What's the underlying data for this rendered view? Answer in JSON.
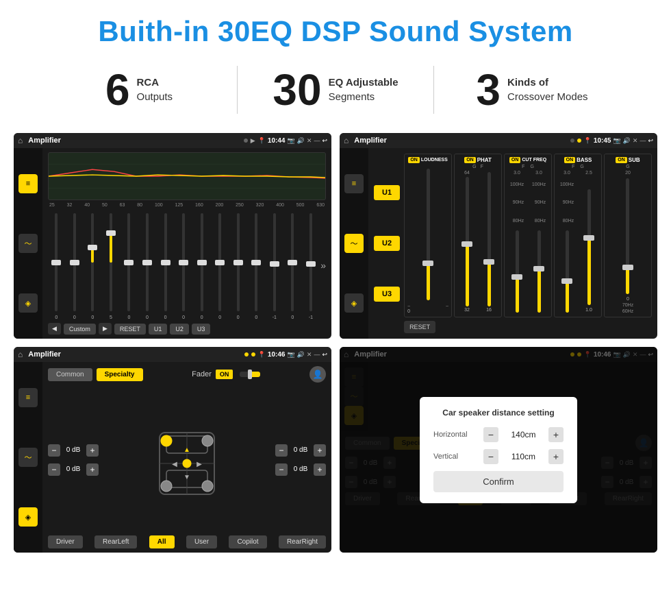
{
  "page": {
    "title": "Buith-in 30EQ DSP Sound System",
    "stats": [
      {
        "number": "6",
        "line1": "RCA",
        "line2": "Outputs"
      },
      {
        "number": "30",
        "line1": "EQ Adjustable",
        "line2": "Segments"
      },
      {
        "number": "3",
        "line1": "Kinds of",
        "line2": "Crossover Modes"
      }
    ]
  },
  "screens": {
    "eq": {
      "title": "Amplifier",
      "time": "10:44",
      "freqs": [
        "25",
        "32",
        "40",
        "50",
        "63",
        "80",
        "100",
        "125",
        "160",
        "200",
        "250",
        "320",
        "400",
        "500",
        "630"
      ],
      "vals": [
        "0",
        "0",
        "0",
        "5",
        "0",
        "0",
        "0",
        "0",
        "0",
        "0",
        "0",
        "0",
        "-1",
        "0",
        "-1"
      ],
      "buttons": [
        "Custom",
        "RESET",
        "U1",
        "U2",
        "U3"
      ]
    },
    "crossover": {
      "title": "Amplifier",
      "time": "10:45",
      "u_buttons": [
        "U1",
        "U2",
        "U3"
      ],
      "cols": [
        {
          "label": "LOUDNESS",
          "on": true
        },
        {
          "label": "PHAT",
          "on": true
        },
        {
          "label": "CUT FREQ",
          "on": true
        },
        {
          "label": "BASS",
          "on": true
        },
        {
          "label": "SUB",
          "on": true
        }
      ],
      "reset": "RESET"
    },
    "fader": {
      "title": "Amplifier",
      "time": "10:46",
      "tabs": [
        "Common",
        "Specialty"
      ],
      "active_tab": "Specialty",
      "fader_label": "Fader",
      "on_label": "ON",
      "db_values": [
        "0 dB",
        "0 dB",
        "0 dB",
        "0 dB"
      ],
      "bottom_buttons": [
        "Driver",
        "All",
        "User",
        "RearLeft",
        "RearRight",
        "Copilot"
      ]
    },
    "distance": {
      "title": "Amplifier",
      "time": "10:46",
      "tabs": [
        "Common",
        "Specialty"
      ],
      "dialog_title": "Car speaker distance setting",
      "horizontal_label": "Horizontal",
      "horizontal_value": "140cm",
      "vertical_label": "Vertical",
      "vertical_value": "110cm",
      "confirm_label": "Confirm",
      "db_values": [
        "0 dB",
        "0 dB"
      ],
      "bottom_buttons": [
        "Driver",
        "All",
        "User",
        "RearLeft",
        "RearRight",
        "Copilot"
      ]
    }
  }
}
